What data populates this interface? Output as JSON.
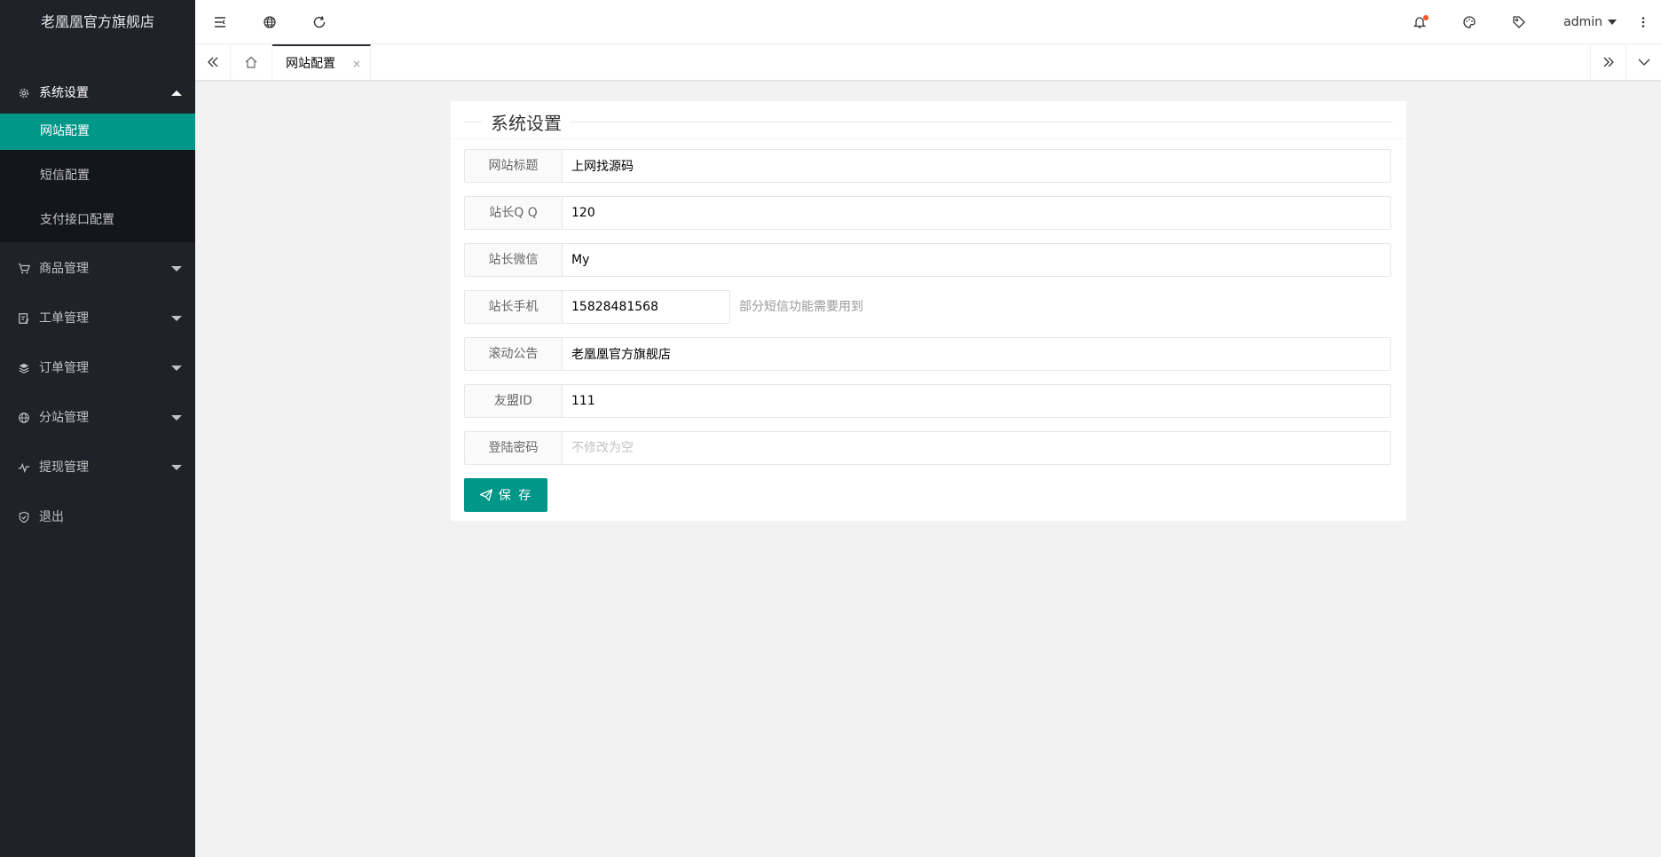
{
  "app": {
    "logo_text": "老凰凰官方旗舰店"
  },
  "sidebar": {
    "items": [
      {
        "label": "系统设置",
        "icon": "gear-icon",
        "expanded": true,
        "children": [
          {
            "label": "网站配置",
            "active": true
          },
          {
            "label": "短信配置"
          },
          {
            "label": "支付接口配置"
          }
        ]
      },
      {
        "label": "商品管理",
        "icon": "cart-icon"
      },
      {
        "label": "工单管理",
        "icon": "ticket-icon"
      },
      {
        "label": "订单管理",
        "icon": "layers-icon"
      },
      {
        "label": "分站管理",
        "icon": "globe-icon"
      },
      {
        "label": "提现管理",
        "icon": "pulse-icon"
      },
      {
        "label": "退出",
        "icon": "shield-icon"
      }
    ]
  },
  "header": {
    "user_name": "admin",
    "icons": [
      "menu-fold-icon",
      "globe-icon",
      "refresh-icon",
      "bell-icon",
      "palette-icon",
      "tag-icon",
      "more-vertical-icon"
    ],
    "notification_dot_color": "#ff5722"
  },
  "tabs": {
    "items": [
      {
        "label": "网站配置",
        "close_glyph": "×"
      }
    ]
  },
  "form": {
    "legend": "系统设置",
    "fields": [
      {
        "label": "网站标题",
        "value": "上网找源码",
        "placeholder": ""
      },
      {
        "label": "站长Q Q",
        "value": "120",
        "placeholder": ""
      },
      {
        "label": "站长微信",
        "value": "My",
        "placeholder": ""
      },
      {
        "label": "站长手机",
        "value": "15828481568",
        "placeholder": "",
        "aux": "部分短信功能需要用到"
      },
      {
        "label": "滚动公告",
        "value": "老凰凰官方旗舰店",
        "placeholder": ""
      },
      {
        "label": "友盟ID",
        "value": "111",
        "placeholder": ""
      },
      {
        "label": "登陆密码",
        "value": "",
        "placeholder": "不修改为空"
      }
    ],
    "save_label": "保 存"
  },
  "colors": {
    "accent": "#009688",
    "sidebar_bg": "#20222a",
    "submenu_bg": "#14161b"
  }
}
